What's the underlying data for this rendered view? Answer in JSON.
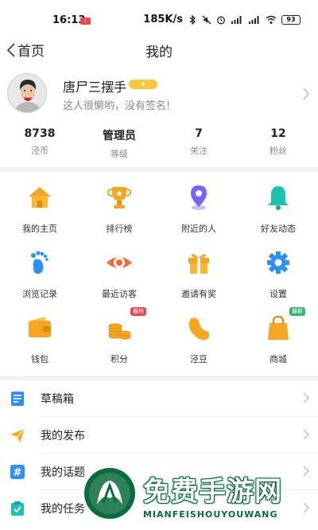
{
  "status_bar": {
    "time": "16:13",
    "network_speed": "185K/s",
    "battery": "93",
    "icons": [
      "bluetooth-icon",
      "mute-icon",
      "alarm-icon",
      "signal-icon",
      "wifi-icon",
      "battery-icon"
    ]
  },
  "nav": {
    "back_label": "首页",
    "title": "我的"
  },
  "profile": {
    "username": "唐尸三摆手",
    "signature": "这人很懒哟，没有签名!",
    "badge_color": "#f5c742"
  },
  "stats": [
    {
      "value": "8738",
      "label": "泾币"
    },
    {
      "value": "管理员",
      "label": "等级"
    },
    {
      "value": "7",
      "label": "关注"
    },
    {
      "value": "12",
      "label": "粉丝"
    }
  ],
  "grid": [
    {
      "label": "我的主页",
      "icon": "home-icon"
    },
    {
      "label": "排行榜",
      "icon": "trophy-icon"
    },
    {
      "label": "附近的人",
      "icon": "location-pin-icon"
    },
    {
      "label": "好友动态",
      "icon": "bell-icon"
    },
    {
      "label": "浏览记录",
      "icon": "footprint-icon"
    },
    {
      "label": "最近访客",
      "icon": "eye-icon"
    },
    {
      "label": "邀请有奖",
      "icon": "gift-icon"
    },
    {
      "label": "设置",
      "icon": "gear-icon"
    },
    {
      "label": "钱包",
      "icon": "wallet-icon"
    },
    {
      "label": "积分",
      "icon": "coins-icon",
      "badge": "最热"
    },
    {
      "label": "泾豆",
      "icon": "bean-icon"
    },
    {
      "label": "商城",
      "icon": "shopping-bag-icon",
      "badge": "最新"
    }
  ],
  "list": [
    {
      "label": "草稿箱",
      "icon": "drafts-icon"
    },
    {
      "label": "我的发布",
      "icon": "send-icon"
    },
    {
      "label": "我的话题",
      "icon": "hashtag-icon"
    },
    {
      "label": "我的任务",
      "icon": "task-icon"
    }
  ],
  "watermark": {
    "title": "免费手游网",
    "subtitle": "MIANFEISHOUYOUWANG"
  },
  "colors": {
    "icon_orange": "#f5a623",
    "icon_purple": "#7b61ff",
    "icon_teal": "#21c0b0",
    "icon_blue": "#2f8ff3",
    "badge_red": "#e5484d",
    "badge_green": "#3cb371",
    "watermark_green": "#0a6b3e"
  }
}
